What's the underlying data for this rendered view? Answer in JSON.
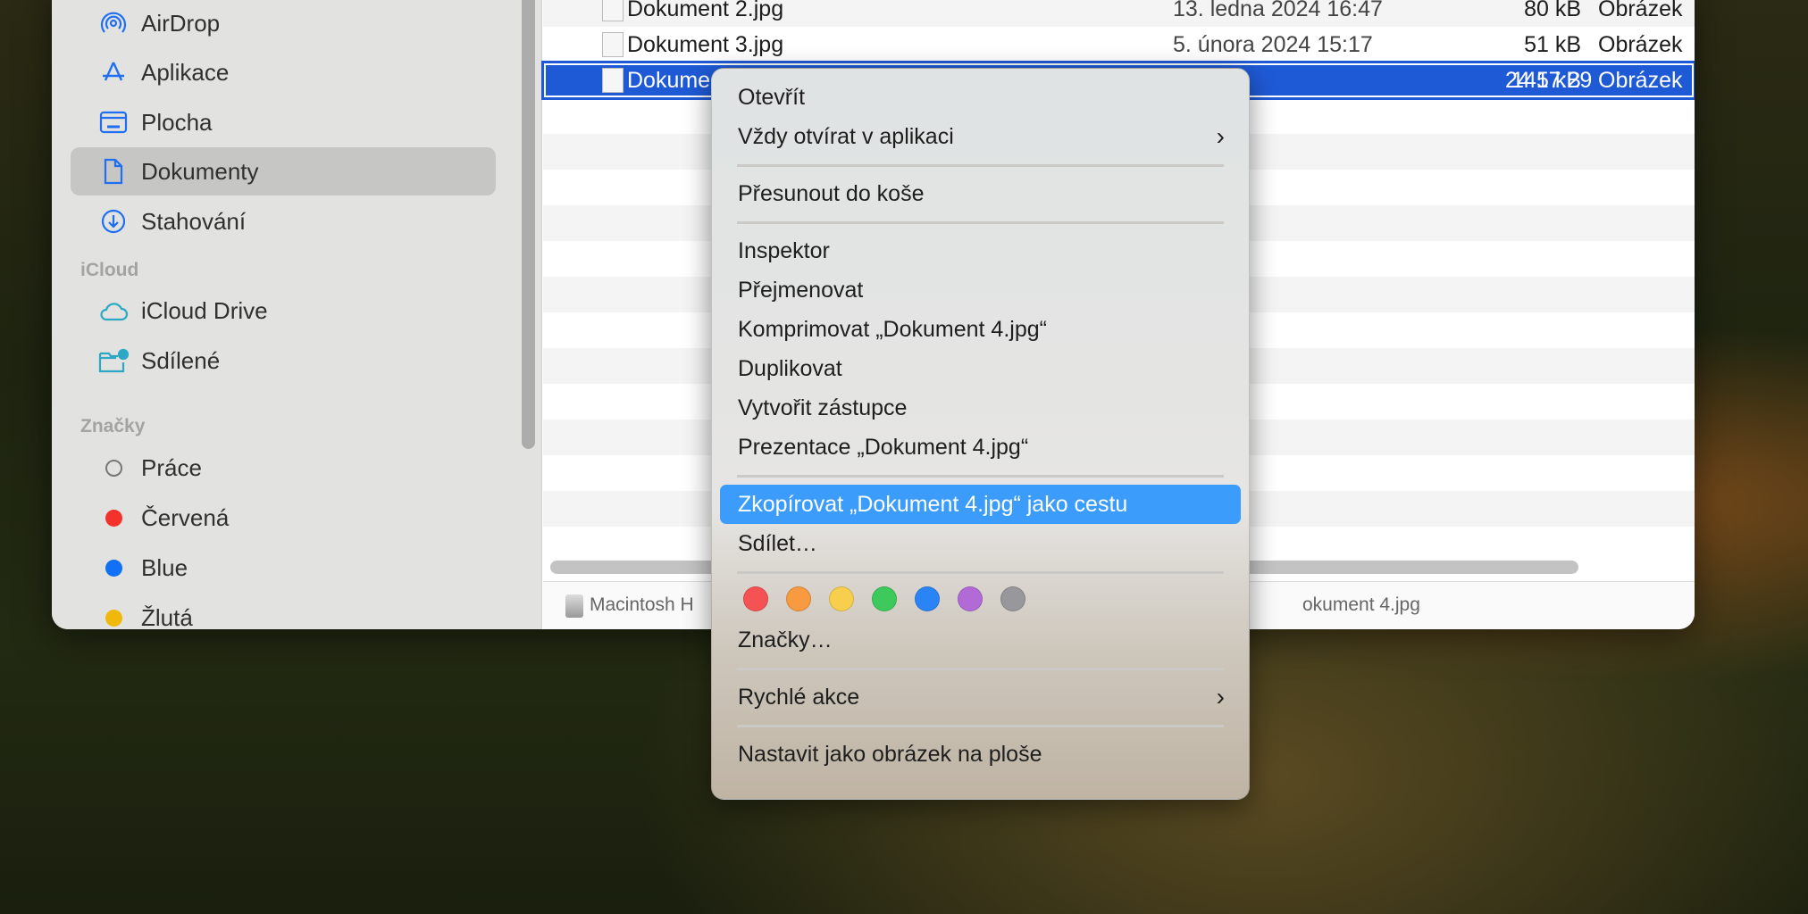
{
  "sidebar": {
    "items": [
      {
        "label": "AirDrop",
        "icon": "airdrop-icon"
      },
      {
        "label": "Aplikace",
        "icon": "applications-icon"
      },
      {
        "label": "Plocha",
        "icon": "desktop-icon"
      },
      {
        "label": "Dokumenty",
        "icon": "document-icon",
        "selected": true
      },
      {
        "label": "Stahování",
        "icon": "download-icon"
      }
    ],
    "icloud_header": "iCloud",
    "icloud_items": [
      {
        "label": "iCloud Drive",
        "icon": "cloud-icon"
      },
      {
        "label": "Sdílené",
        "icon": "shared-folder-icon"
      }
    ],
    "tags_header": "Značky",
    "tags": [
      {
        "label": "Práce",
        "color": ""
      },
      {
        "label": "Červená",
        "color": "#f4322c"
      },
      {
        "label": "Blue",
        "color": "#1170f5"
      },
      {
        "label": "Žlutá",
        "color": "#f0b80a"
      }
    ]
  },
  "files": [
    {
      "name": "Dokument 2.jpg",
      "date": "13. ledna 2024 16:47",
      "size": "80 kB",
      "kind": "Obrázek"
    },
    {
      "name": "Dokument 3.jpg",
      "date": "5. února 2024 15:17",
      "size": "51 kB",
      "kind": "Obrázek"
    },
    {
      "name": "Dokument 4.jpg",
      "name_visible": "Dokume",
      "date": "24 17:29",
      "size": "145 kB",
      "kind": "Obrázek",
      "selected": true
    }
  ],
  "pathbar": {
    "left": "Macintosh H",
    "right": "okument 4.jpg"
  },
  "context_menu": {
    "items": [
      {
        "label": "Otevřít"
      },
      {
        "label": "Vždy otvírat v aplikaci",
        "submenu": true
      },
      {
        "sep": true
      },
      {
        "label": "Přesunout do koše"
      },
      {
        "sep": true
      },
      {
        "label": "Inspektor"
      },
      {
        "label": "Přejmenovat"
      },
      {
        "label": "Komprimovat „Dokument 4.jpg“"
      },
      {
        "label": "Duplikovat"
      },
      {
        "label": "Vytvořit zástupce"
      },
      {
        "label": "Prezentace „Dokument 4.jpg“"
      },
      {
        "sep": true
      },
      {
        "label": "Zkopírovat „Dokument 4.jpg“ jako cestu",
        "highlighted": true
      },
      {
        "label": "Sdílet…"
      },
      {
        "sep": true
      },
      {
        "tags": true
      },
      {
        "label": "Značky…"
      },
      {
        "sep": true
      },
      {
        "label": "Rychlé akce",
        "submenu": true
      },
      {
        "sep": true
      },
      {
        "label": "Nastavit jako obrázek na ploše"
      }
    ],
    "tag_colors": [
      "#f55353",
      "#f79a40",
      "#f7cf4d",
      "#3dc95b",
      "#2b84f5",
      "#b16ad6",
      "#98989c"
    ],
    "submenu_glyph": "›"
  }
}
